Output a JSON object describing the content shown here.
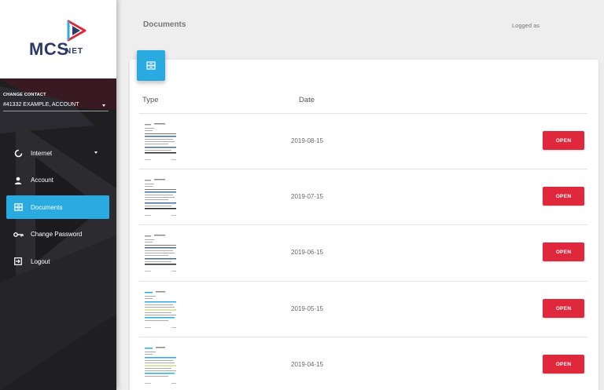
{
  "brand": {
    "name": "MCS",
    "suffix": "NET"
  },
  "contact": {
    "label": "CHANGE CONTACT",
    "value": "#41332 EXAMPLE, ACCOUNT"
  },
  "nav": {
    "items": [
      {
        "label": "Internet",
        "icon": "chart-ring-icon",
        "has_submenu": true
      },
      {
        "label": "Account",
        "icon": "user-icon"
      },
      {
        "label": "Documents",
        "icon": "document-stack-icon",
        "active": true
      },
      {
        "label": "Change Password",
        "icon": "key-icon"
      },
      {
        "label": "Logout",
        "icon": "logout-icon"
      }
    ]
  },
  "header": {
    "title": "Documents",
    "logged_as": "Logged as"
  },
  "table": {
    "columns": {
      "type": "Type",
      "date": "Date"
    },
    "open_label": "OPEN",
    "rows": [
      {
        "date": "2019-08-15"
      },
      {
        "date": "2019-07-15"
      },
      {
        "date": "2019-06-15"
      },
      {
        "date": "2019-05-15"
      },
      {
        "date": "2019-04-15"
      }
    ]
  },
  "colors": {
    "accent": "#29abe2",
    "danger": "#e0283d",
    "sidebar": "#1f1f21",
    "brand_navy": "#2b3a67",
    "brand_red": "#e0283d"
  }
}
